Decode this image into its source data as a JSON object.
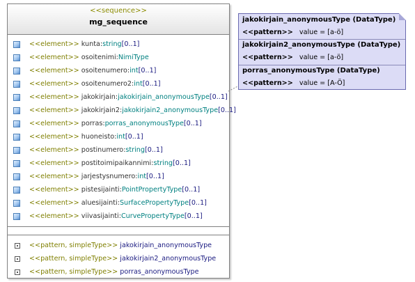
{
  "class": {
    "stereotype": "<<sequence>>",
    "name": "mg_sequence",
    "attributes": [
      {
        "stereotype": "<<element>>",
        "name": "kunta",
        "type": "string",
        "mult": "[0..1]"
      },
      {
        "stereotype": "<<element>>",
        "name": "osoitenimi",
        "type": "NimiType",
        "mult": ""
      },
      {
        "stereotype": "<<element>>",
        "name": "osoitenumero",
        "type": "int",
        "mult": "[0..1]"
      },
      {
        "stereotype": "<<element>>",
        "name": "osoitenumero2",
        "type": "int",
        "mult": "[0..1]"
      },
      {
        "stereotype": "<<element>>",
        "name": "jakokirjain",
        "type": "jakokirjain_anonymousType",
        "mult": "[0..1]"
      },
      {
        "stereotype": "<<element>>",
        "name": "jakokirjain2",
        "type": "jakokirjain2_anonymousType",
        "mult": "[0..1]"
      },
      {
        "stereotype": "<<element>>",
        "name": "porras",
        "type": "porras_anonymousType",
        "mult": "[0..1]"
      },
      {
        "stereotype": "<<element>>",
        "name": "huoneisto",
        "type": "int",
        "mult": "[0..1]"
      },
      {
        "stereotype": "<<element>>",
        "name": "postinumero",
        "type": "string",
        "mult": "[0..1]"
      },
      {
        "stereotype": "<<element>>",
        "name": "postitoimipaikannimi",
        "type": "string",
        "mult": "[0..1]"
      },
      {
        "stereotype": "<<element>>",
        "name": "jarjestysnumero",
        "type": "int",
        "mult": "[0..1]"
      },
      {
        "stereotype": "<<element>>",
        "name": "pistesijainti",
        "type": "PointPropertyType",
        "mult": "[0..1]"
      },
      {
        "stereotype": "<<element>>",
        "name": "aluesijainti",
        "type": "SurfacePropertyType",
        "mult": "[0..1]"
      },
      {
        "stereotype": "<<element>>",
        "name": "viivasijainti",
        "type": "CurvePropertyType",
        "mult": "[0..1]"
      }
    ],
    "nested_types": [
      {
        "stereotype": "<<pattern, simpleType>>",
        "name": "jakokirjain_anonymousType"
      },
      {
        "stereotype": "<<pattern, simpleType>>",
        "name": "jakokirjain2_anonymousType"
      },
      {
        "stereotype": "<<pattern, simpleType>>",
        "name": "porras_anonymousType"
      }
    ]
  },
  "note": {
    "datatypes": [
      {
        "title": "jakokirjain_anonymousType (DataType)",
        "pattern_label": "<<pattern>>",
        "pattern_value": "value = [a-ö]"
      },
      {
        "title": "jakokirjain2_anonymousType (DataType)",
        "pattern_label": "<<pattern>>",
        "pattern_value": "value = [a-ö]"
      },
      {
        "title": "porras_anonymousType (DataType)",
        "pattern_label": "<<pattern>>",
        "pattern_value": "value = [A-Ö]"
      }
    ]
  },
  "colors": {
    "stereotype": "#7f7f00",
    "type": "#008080",
    "note_fill": "#dcdcf6"
  }
}
